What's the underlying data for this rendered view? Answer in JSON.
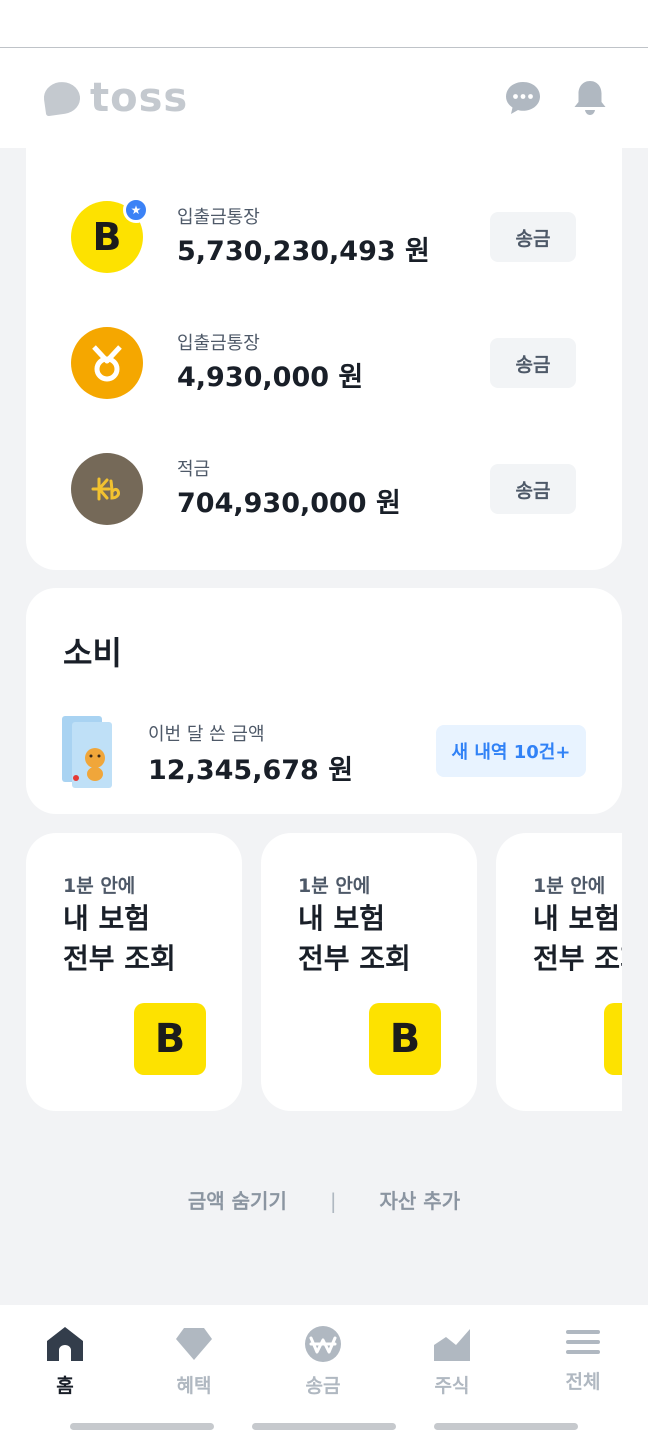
{
  "header": {
    "app_name": "toss",
    "icons": [
      "chat-icon",
      "bell-icon"
    ]
  },
  "accounts": [
    {
      "bank": "kakaobank",
      "name": "입출금통장",
      "amount": "5,730,230,493 원",
      "send_label": "송금",
      "starred": true
    },
    {
      "bank": "woori",
      "name": "입출금통장",
      "amount": "4,930,000 원",
      "send_label": "송금",
      "starred": false
    },
    {
      "bank": "kb",
      "name": "적금",
      "amount": "704,930,000 원",
      "send_label": "송금",
      "starred": false
    }
  ],
  "spending": {
    "title": "소비",
    "label": "이번 달 쓴 금액",
    "amount": "12,345,678 원",
    "new_button": "새 내역 10건+"
  },
  "promos": [
    {
      "subtitle": "1분 안에",
      "title": "내 보험\n전부 조회"
    },
    {
      "subtitle": "1분 안에",
      "title": "내 보험\n전부 조회"
    },
    {
      "subtitle": "1분 안에",
      "title": "내 보험\n전부 조회"
    }
  ],
  "footer": {
    "hide_amount": "금액 숨기기",
    "separator": "|",
    "add_asset": "자산 추가"
  },
  "tabs": [
    {
      "label": "홈",
      "icon": "home-icon",
      "active": true
    },
    {
      "label": "혜택",
      "icon": "diamond-icon",
      "active": false
    },
    {
      "label": "송금",
      "icon": "won-icon",
      "active": false
    },
    {
      "label": "주식",
      "icon": "chart-icon",
      "active": false
    },
    {
      "label": "전체",
      "icon": "menu-icon",
      "active": false
    }
  ],
  "colors": {
    "accent_blue": "#3182f6",
    "kakao_yellow": "#fde200",
    "woori_orange": "#f5a700",
    "kb_brown": "#756958",
    "background": "#f2f3f5"
  }
}
